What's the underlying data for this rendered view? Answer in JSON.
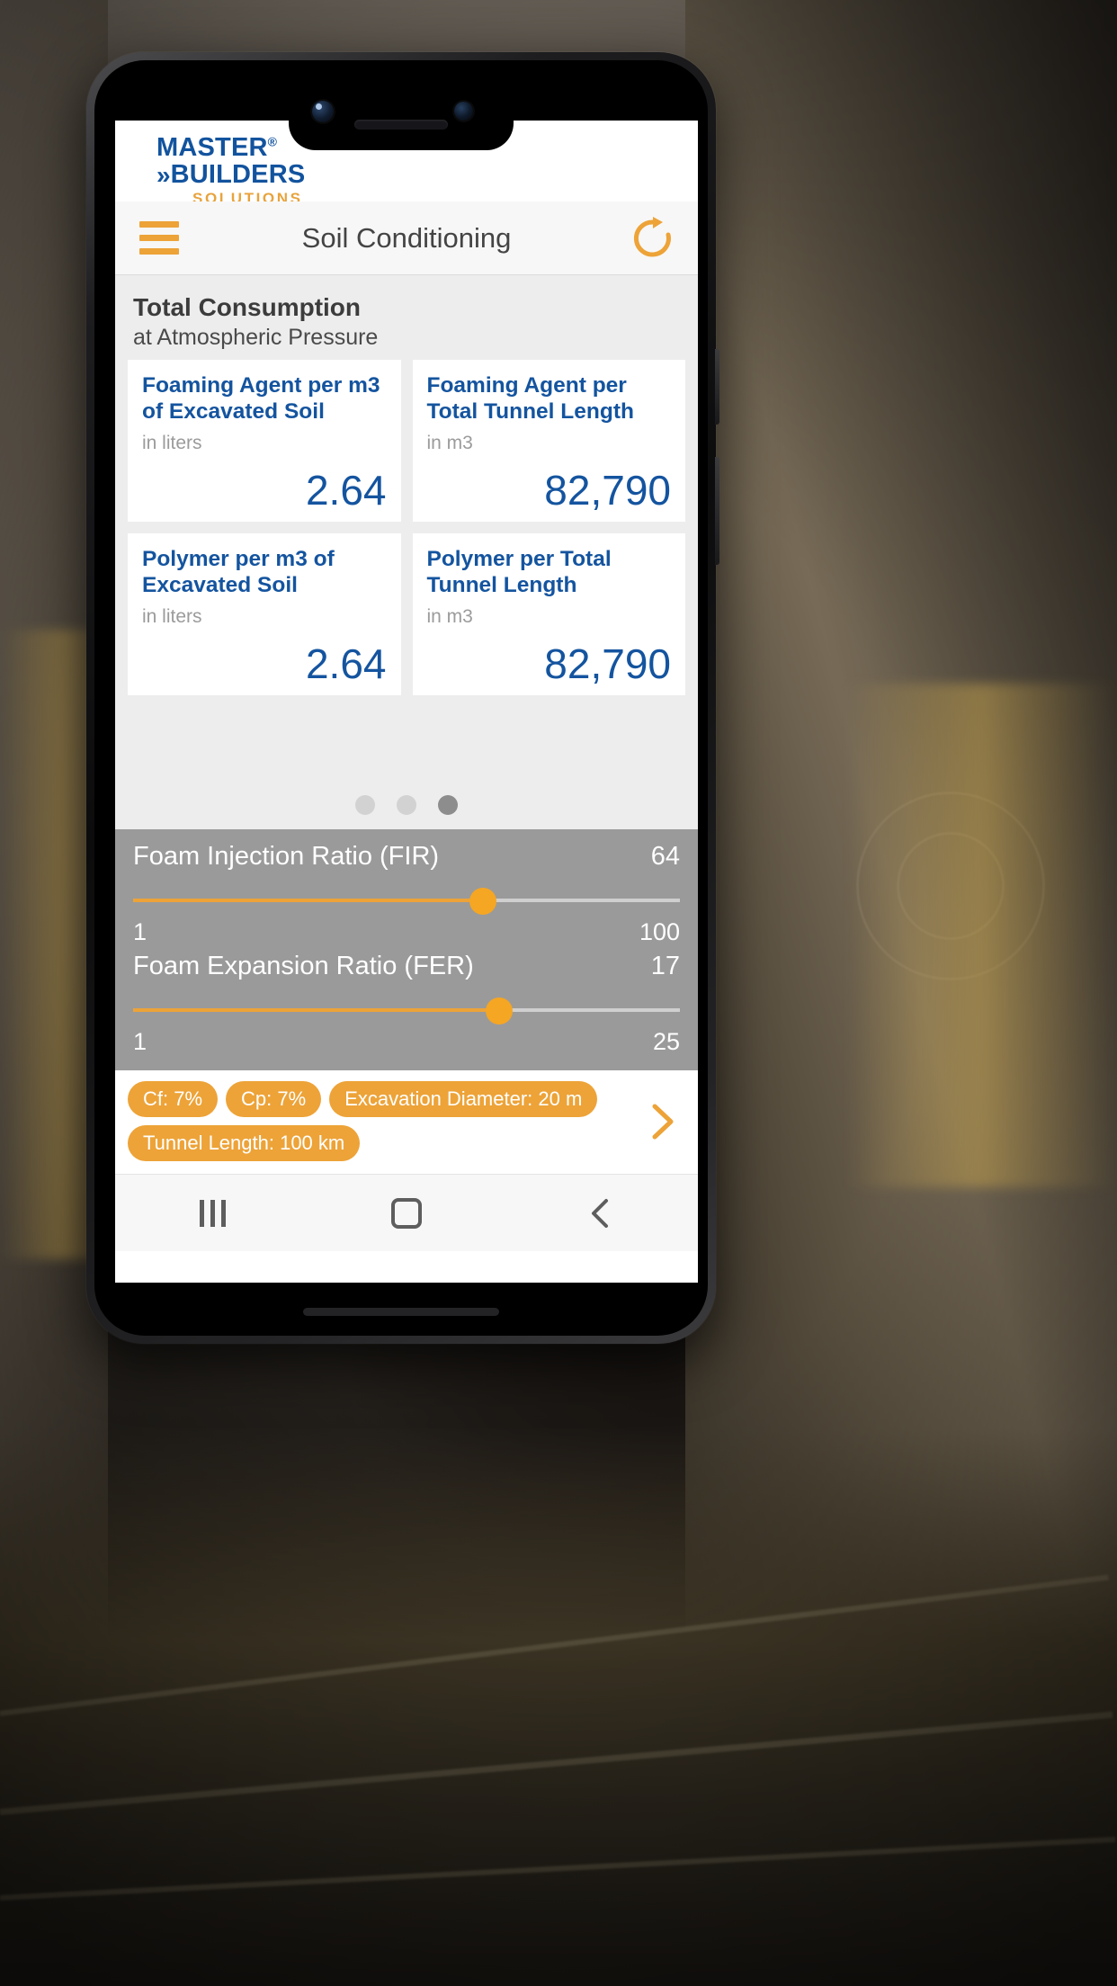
{
  "logo": {
    "line1": "MASTER",
    "registered": "®",
    "chevrons": "»",
    "line2": "BUILDERS",
    "line3": "SOLUTIONS",
    "blue": "#12539e",
    "orange": "#e8a33d"
  },
  "toolbar": {
    "menu_icon": "hamburger-menu-icon",
    "title": "Soil Conditioning",
    "refresh_icon": "refresh-icon",
    "accent": "#eda338"
  },
  "section": {
    "title": "Total Consumption",
    "subtitle": "at Atmospheric Pressure"
  },
  "cards": [
    {
      "title": "Foaming Agent per m3 of Excavated Soil",
      "unit": "in liters",
      "value": "2.64"
    },
    {
      "title": "Foaming Agent per Total Tunnel Length",
      "unit": "in m3",
      "value": "82,790"
    },
    {
      "title": "Polymer per m3 of Excavated Soil",
      "unit": "in liters",
      "value": "2.64"
    },
    {
      "title": "Polymer per Total Tunnel Length",
      "unit": "in m3",
      "value": "82,790"
    }
  ],
  "pagination": {
    "count": 3,
    "active_index": 2
  },
  "sliders": [
    {
      "label": "Foam Injection Ratio (FIR)",
      "value": "64",
      "min": "1",
      "max": "100",
      "percent": 64
    },
    {
      "label": "Foam Expansion Ratio (FER)",
      "value": "17",
      "min": "1",
      "max": "25",
      "percent": 67
    }
  ],
  "chips": [
    "Cf: 7%",
    "Cp: 7%",
    "Excavation Diameter: 20 m",
    "Tunnel Length: 100 km"
  ],
  "chips_arrow_icon": "chevron-right-icon",
  "navbar": {
    "recent_icon": "recent-apps-icon",
    "home_icon": "home-icon",
    "back_icon": "back-icon"
  }
}
